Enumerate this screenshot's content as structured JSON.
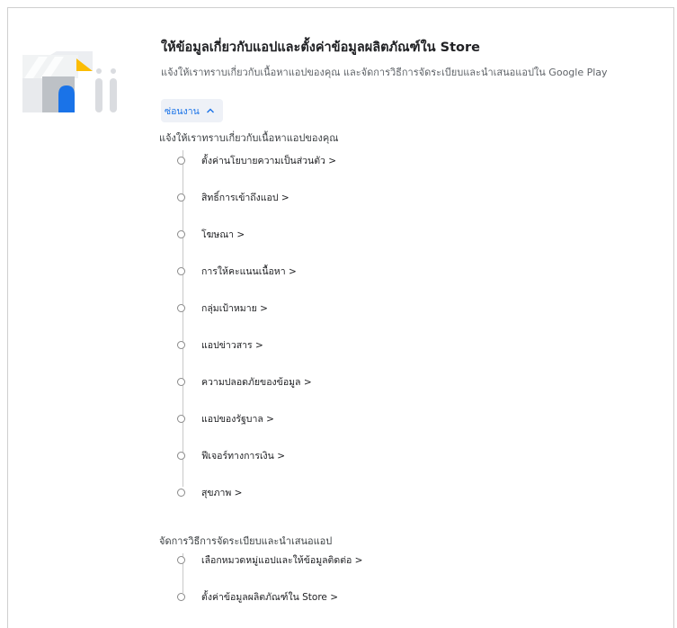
{
  "header": {
    "title": "ให้ข้อมูลเกี่ยวกับแอปและตั้งค่าข้อมูลผลิตภัณฑ์ใน Store",
    "subtitle": "แจ้งให้เราทราบเกี่ยวกับเนื้อหาแอปของคุณ และจัดการวิธีการจัดระเบียบและนำเสนอแอปใน Google Play"
  },
  "toggle": {
    "label": "ซ่อนงาน",
    "icon": "chevron-up-icon"
  },
  "sections": [
    {
      "heading": "แจ้งให้เราทราบเกี่ยวกับเนื้อหาแอปของคุณ",
      "items": [
        "ตั้งค่านโยบายความเป็นส่วนตัว >",
        "สิทธิ์การเข้าถึงแอป >",
        "โฆษณา >",
        "การให้คะแนนเนื้อหา >",
        "กลุ่มเป้าหมาย >",
        "แอปข่าวสาร >",
        "ความปลอดภัยของข้อมูล >",
        "แอปของรัฐบาล >",
        "ฟีเจอร์ทางการเงิน >",
        "สุขภาพ >"
      ]
    },
    {
      "heading": "จัดการวิธีการจัดระเบียบและนำเสนอแอป",
      "items": [
        "เลือกหมวดหมู่แอปและให้ข้อมูลติดต่อ >",
        "ตั้งค่าข้อมูลผลิตภัณฑ์ใน Store >"
      ]
    }
  ],
  "colors": {
    "accent": "#1a73e8",
    "toggle_bg": "#eef1f7",
    "illus_blue": "#1a73e8",
    "illus_yellow": "#fbbc04"
  }
}
